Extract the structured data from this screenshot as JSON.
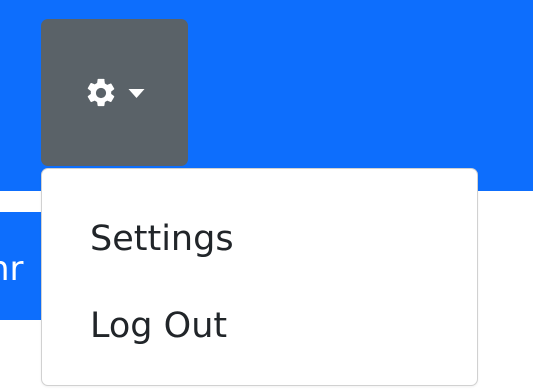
{
  "navbar": {
    "color": "#0d6efd",
    "partial_text": "nr"
  },
  "settings_menu": {
    "toggle_icon": "gear-icon",
    "toggle_caret_icon": "caret-down-icon",
    "toggle_bg": "#5a6268",
    "items": [
      {
        "label": "Settings"
      },
      {
        "label": "Log Out"
      }
    ]
  }
}
